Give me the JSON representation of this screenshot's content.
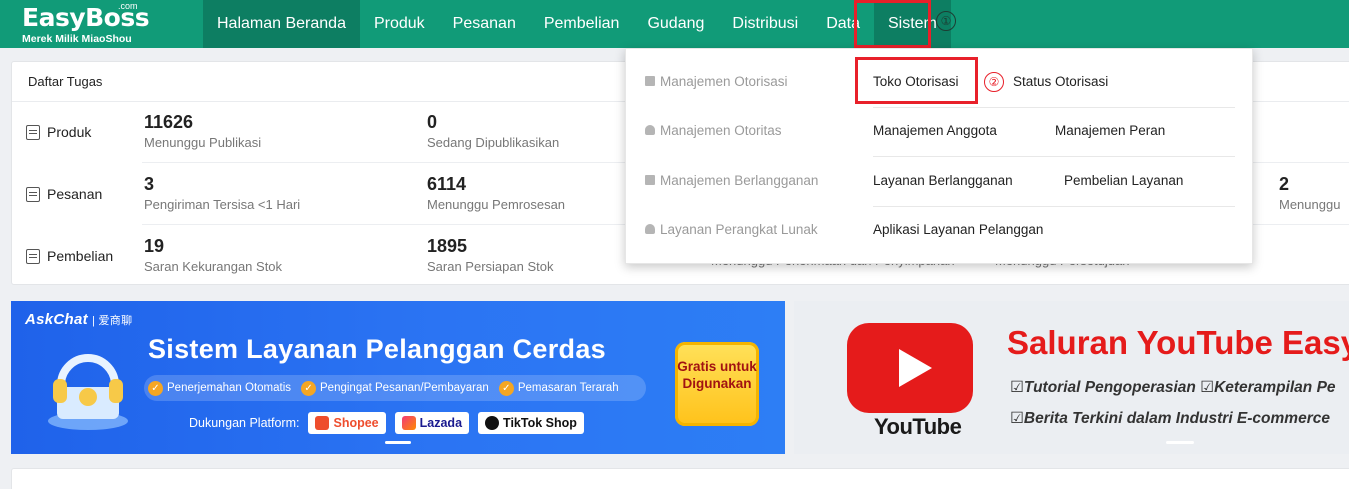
{
  "logo": {
    "name": "EasyBoss",
    "suffix": ".com",
    "subtitle": "Merek Milik MiaoShou"
  },
  "nav": {
    "items": [
      {
        "label": "Halaman Beranda"
      },
      {
        "label": "Produk"
      },
      {
        "label": "Pesanan"
      },
      {
        "label": "Pembelian"
      },
      {
        "label": "Gudang"
      },
      {
        "label": "Distribusi"
      },
      {
        "label": "Data"
      },
      {
        "label": "Sistem"
      }
    ],
    "step1": "①",
    "step2": "②"
  },
  "tasks": {
    "title": "Daftar Tugas",
    "rows": [
      {
        "label": "Produk",
        "icon": "product-doc-icon",
        "stats": [
          {
            "num": "11626",
            "label": "Menunggu Publikasi"
          },
          {
            "num": "0",
            "label": "Sedang Dipublikasikan"
          }
        ]
      },
      {
        "label": "Pesanan",
        "icon": "order-doc-icon",
        "stats": [
          {
            "num": "3",
            "label": "Pengiriman Tersisa <1 Hari"
          },
          {
            "num": "6114",
            "label": "Menunggu Pemrosesan"
          }
        ],
        "right_stat": {
          "num": "2",
          "label": "Menunggu"
        }
      },
      {
        "label": "Pembelian",
        "icon": "purchase-doc-icon",
        "stats": [
          {
            "num": "19",
            "label": "Saran Kekurangan Stok"
          },
          {
            "num": "1895",
            "label": "Saran Persiapan Stok"
          }
        ],
        "hidden_stats": [
          "Menunggu Penerimaan dan Penyimpanan",
          "Menunggu Persetujuan"
        ]
      }
    ]
  },
  "dropdown": {
    "rows": [
      {
        "category": "Manajemen Otorisasi",
        "links": [
          "Toko Otorisasi",
          "Status Otorisasi"
        ]
      },
      {
        "category": "Manajemen Otoritas",
        "links": [
          "Manajemen Anggota",
          "Manajemen Peran"
        ]
      },
      {
        "category": "Manajemen Berlangganan",
        "links": [
          "Layanan Berlangganan",
          "Pembelian Layanan"
        ]
      },
      {
        "category": "Layanan Perangkat Lunak",
        "links": [
          "Aplikasi Layanan Pelanggan"
        ]
      }
    ]
  },
  "banner_left": {
    "brand": "AskChat",
    "brand_cn": "| 爱商聊",
    "title": "Sistem Layanan Pelanggan Cerdas",
    "features": [
      "Penerjemahan Otomatis",
      "Pengingat Pesanan/Pembayaran",
      "Pemasaran Terarah"
    ],
    "platform_label": "Dukungan Platform:",
    "platforms": [
      "Shopee",
      "Lazada",
      "TikTok Shop"
    ],
    "cta": "Gratis untuk Digunakan"
  },
  "banner_right": {
    "logo_text": "YouTube",
    "title": "Saluran YouTube EasyBo",
    "line1": "☑Tutorial Pengoperasian  ☑Keterampilan Pe",
    "line2": "☑Berita Terkini dalam Industri E-commerce"
  },
  "colors": {
    "brand_green": "#119b78",
    "active_green": "#0d7e62",
    "highlight_red": "#e8202a",
    "banner_blue": "#2b74f3",
    "youtube_red": "#e51b1b"
  }
}
